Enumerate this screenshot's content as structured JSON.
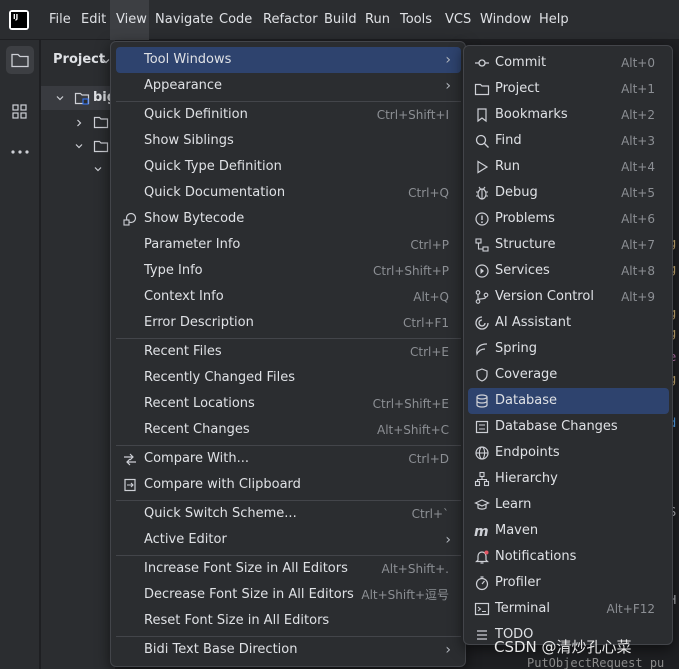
{
  "menubar": {
    "logo_text": "IJ",
    "items": [
      {
        "name": "menu-file",
        "label": "File"
      },
      {
        "name": "menu-edit",
        "label": "Edit"
      },
      {
        "name": "menu-view",
        "label": "View"
      },
      {
        "name": "menu-navigate",
        "label": "Navigate"
      },
      {
        "name": "menu-code",
        "label": "Code"
      },
      {
        "name": "menu-refactor",
        "label": "Refactor"
      },
      {
        "name": "menu-build",
        "label": "Build"
      },
      {
        "name": "menu-run",
        "label": "Run"
      },
      {
        "name": "menu-tools",
        "label": "Tools"
      },
      {
        "name": "menu-vcs",
        "label": "VCS"
      },
      {
        "name": "menu-window",
        "label": "Window"
      },
      {
        "name": "menu-help",
        "label": "Help"
      }
    ]
  },
  "project_panel": {
    "title": "Project",
    "root_label": "big"
  },
  "view_menu": {
    "items": [
      {
        "label": "Tool Windows",
        "shortcut": "",
        "submenu": true,
        "highlighted": true
      },
      {
        "label": "Appearance",
        "shortcut": "",
        "submenu": true
      },
      {
        "label": "Quick Definition",
        "shortcut": "Ctrl+Shift+I"
      },
      {
        "label": "Show Siblings",
        "shortcut": ""
      },
      {
        "label": "Quick Type Definition",
        "shortcut": ""
      },
      {
        "label": "Quick Documentation",
        "shortcut": "Ctrl+Q"
      },
      {
        "label": "Show Bytecode",
        "shortcut": "",
        "icon": "bytecode-icon"
      },
      {
        "label": "Parameter Info",
        "shortcut": "Ctrl+P"
      },
      {
        "label": "Type Info",
        "shortcut": "Ctrl+Shift+P"
      },
      {
        "label": "Context Info",
        "shortcut": "Alt+Q"
      },
      {
        "label": "Error Description",
        "shortcut": "Ctrl+F1"
      },
      {
        "label": "Recent Files",
        "shortcut": "Ctrl+E"
      },
      {
        "label": "Recently Changed Files",
        "shortcut": ""
      },
      {
        "label": "Recent Locations",
        "shortcut": "Ctrl+Shift+E"
      },
      {
        "label": "Recent Changes",
        "shortcut": "Alt+Shift+C"
      },
      {
        "label": "Compare With...",
        "shortcut": "Ctrl+D",
        "icon": "compare-icon"
      },
      {
        "label": "Compare with Clipboard",
        "shortcut": "",
        "icon": "clipboard-compare-icon"
      },
      {
        "label": "Quick Switch Scheme...",
        "shortcut": "Ctrl+`"
      },
      {
        "label": "Active Editor",
        "shortcut": "",
        "submenu": true
      },
      {
        "label": "Increase Font Size in All Editors",
        "shortcut": "Alt+Shift+."
      },
      {
        "label": "Decrease Font Size in All Editors",
        "shortcut": "Alt+Shift+逗号"
      },
      {
        "label": "Reset Font Size in All Editors",
        "shortcut": ""
      },
      {
        "label": "Bidi Text Base Direction",
        "shortcut": "",
        "submenu": true
      }
    ]
  },
  "tool_windows_menu": {
    "items": [
      {
        "label": "Commit",
        "shortcut": "Alt+0",
        "icon": "commit-icon"
      },
      {
        "label": "Project",
        "shortcut": "Alt+1",
        "icon": "folder-icon"
      },
      {
        "label": "Bookmarks",
        "shortcut": "Alt+2",
        "icon": "bookmark-icon"
      },
      {
        "label": "Find",
        "shortcut": "Alt+3",
        "icon": "search-icon"
      },
      {
        "label": "Run",
        "shortcut": "Alt+4",
        "icon": "run-icon"
      },
      {
        "label": "Debug",
        "shortcut": "Alt+5",
        "icon": "debug-icon"
      },
      {
        "label": "Problems",
        "shortcut": "Alt+6",
        "icon": "problems-icon"
      },
      {
        "label": "Structure",
        "shortcut": "Alt+7",
        "icon": "structure-icon"
      },
      {
        "label": "Services",
        "shortcut": "Alt+8",
        "icon": "services-icon"
      },
      {
        "label": "Version Control",
        "shortcut": "Alt+9",
        "icon": "vcs-icon"
      },
      {
        "label": "AI Assistant",
        "shortcut": "",
        "icon": "ai-assistant-icon"
      },
      {
        "label": "Spring",
        "shortcut": "",
        "icon": "spring-icon"
      },
      {
        "label": "Coverage",
        "shortcut": "",
        "icon": "coverage-icon"
      },
      {
        "label": "Database",
        "shortcut": "",
        "icon": "database-icon",
        "highlighted": true
      },
      {
        "label": "Database Changes",
        "shortcut": "",
        "icon": "database-changes-icon"
      },
      {
        "label": "Endpoints",
        "shortcut": "",
        "icon": "endpoints-icon"
      },
      {
        "label": "Hierarchy",
        "shortcut": "",
        "icon": "hierarchy-icon"
      },
      {
        "label": "Learn",
        "shortcut": "",
        "icon": "learn-icon"
      },
      {
        "label": "Maven",
        "shortcut": "",
        "icon": "maven-icon"
      },
      {
        "label": "Notifications",
        "shortcut": "",
        "icon": "notifications-icon"
      },
      {
        "label": "Profiler",
        "shortcut": "",
        "icon": "profiler-icon"
      },
      {
        "label": "Terminal",
        "shortcut": "Alt+F12",
        "icon": "terminal-icon"
      },
      {
        "label": "TODO",
        "shortcut": "",
        "icon": "todo-icon"
      }
    ]
  },
  "editor": {
    "code_fragments": [
      "g",
      "g",
      "g",
      "g",
      "e",
      "g",
      "d",
      "S",
      "H"
    ],
    "bottom_code": "PutObjectRequest pu"
  },
  "watermark": "CSDN @清炒孔心菜",
  "colors": {
    "menubar_bg": "#2b2d30",
    "editor_bg": "#1e1f22",
    "highlight": "#2e436e",
    "text": "#dfe1e5",
    "shortcut": "#8c8f94"
  }
}
